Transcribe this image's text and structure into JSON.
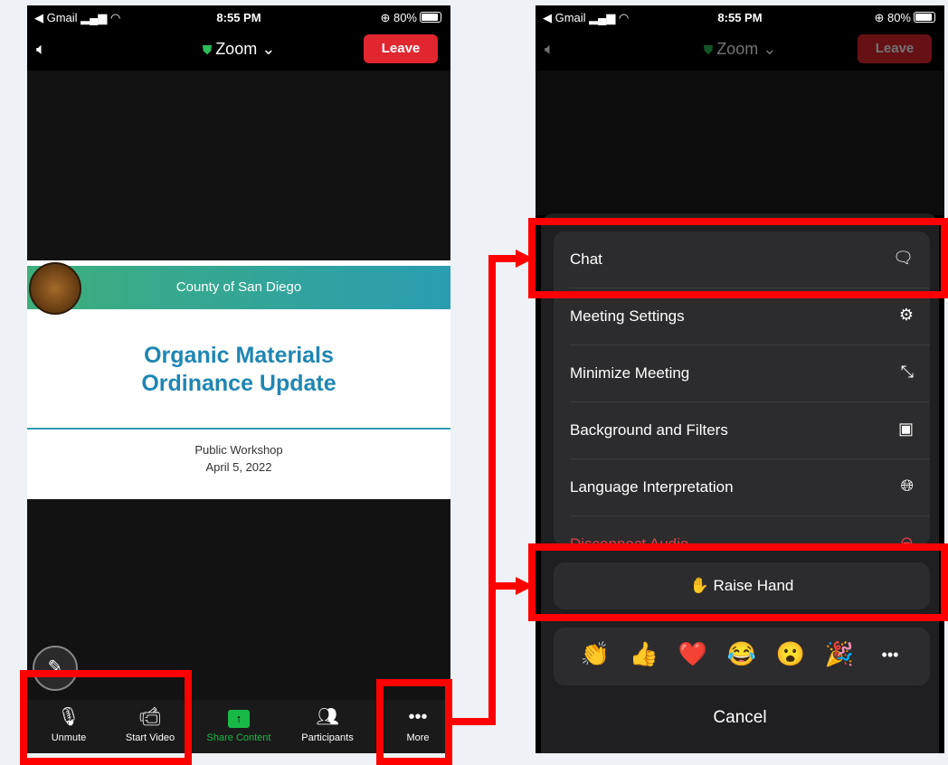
{
  "status": {
    "carrier": "◀ Gmail",
    "time": "8:55 PM",
    "battery": "⊕ 80%"
  },
  "header": {
    "title": "Zoom",
    "leave_label": "Leave"
  },
  "slide": {
    "banner": "County of San Diego",
    "title_line1": "Organic Materials",
    "title_line2": "Ordinance Update",
    "sub_line1": "Public Workshop",
    "sub_line2": "April 5, 2022"
  },
  "toolbar": {
    "unmute": "Unmute",
    "start_video": "Start Video",
    "share_content": "Share Content",
    "participants": "Participants",
    "more": "More"
  },
  "menu": {
    "chat": "Chat",
    "meeting_settings": "Meeting Settings",
    "minimize_meeting": "Minimize Meeting",
    "background_filters": "Background and Filters",
    "language_interpretation": "Language Interpretation",
    "disconnect_audio": "Disconnect Audio"
  },
  "raise_hand": "Raise Hand",
  "reactions": [
    "👏",
    "👍",
    "❤️",
    "😂",
    "😮",
    "🎉"
  ],
  "cancel": "Cancel",
  "colors": {
    "leave": "#e0262e",
    "share": "#19b948",
    "highlight": "#ff0000",
    "banner_start": "#3eae7b",
    "banner_end": "#2a9db1"
  }
}
